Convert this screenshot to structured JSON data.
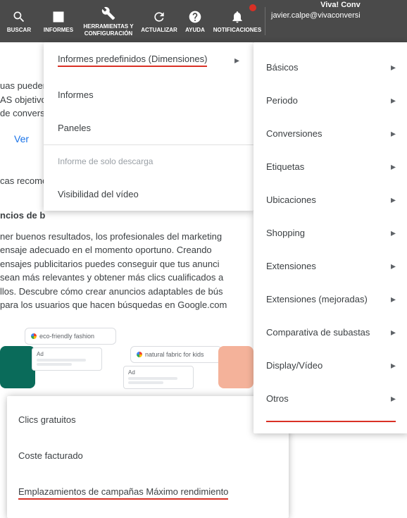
{
  "topbar": {
    "search": "BUSCAR",
    "reports": "INFORMES",
    "tools": "HERRAMIENTAS Y CONFIGURACIÓN",
    "refresh": "ACTUALIZAR",
    "help": "AYUDA",
    "notifications": "NOTIFICACIONES"
  },
  "account": {
    "company": "Viva! Conv",
    "email": "javier.calpe@vivaconversi"
  },
  "reportsMenu": {
    "predefined": "Informes predefinidos (Dimensiones)",
    "informes": "Informes",
    "paneles": "Paneles",
    "downloadOnly": "Informe de solo descarga",
    "videoVis": "Visibilidad del vídeo"
  },
  "categories": {
    "basicos": "Básicos",
    "periodo": "Periodo",
    "conversiones": "Conversiones",
    "etiquetas": "Etiquetas",
    "ubicaciones": "Ubicaciones",
    "shopping": "Shopping",
    "extensiones": "Extensiones",
    "extMejoradas": "Extensiones (mejoradas)",
    "subastas": "Comparativa de subastas",
    "displayVideo": "Display/Vídeo",
    "otros": "Otros"
  },
  "otherMenu": {
    "freeClicks": "Clics gratuitos",
    "billed": "Coste facturado",
    "placements": "Emplazamientos de campañas Máximo rendimiento"
  },
  "bg": {
    "snippet1a": "uas pueden t",
    "snippet1b": "AS objetivo, c",
    "snippet1c": "de conversió",
    "ver": "Ver",
    "rec": "cas recomen",
    "heading": "ncios de b",
    "p1": "ner buenos resultados, los profesionales del marketing",
    "p2": "ensaje adecuado en el momento oportuno. Creando",
    "p3": "ensajes publicitarios puedes conseguir que tus anunci",
    "p4": " sean más relevantes y obtener más clics cualificados a",
    "p5": "llos. Descubre cómo crear anuncios adaptables de bús",
    "p6": " para los usuarios que hacen búsquedas en Google.com",
    "eco": "eco-friendly fashion",
    "natural": "natural fabric for kids",
    "ad": "Ad"
  }
}
